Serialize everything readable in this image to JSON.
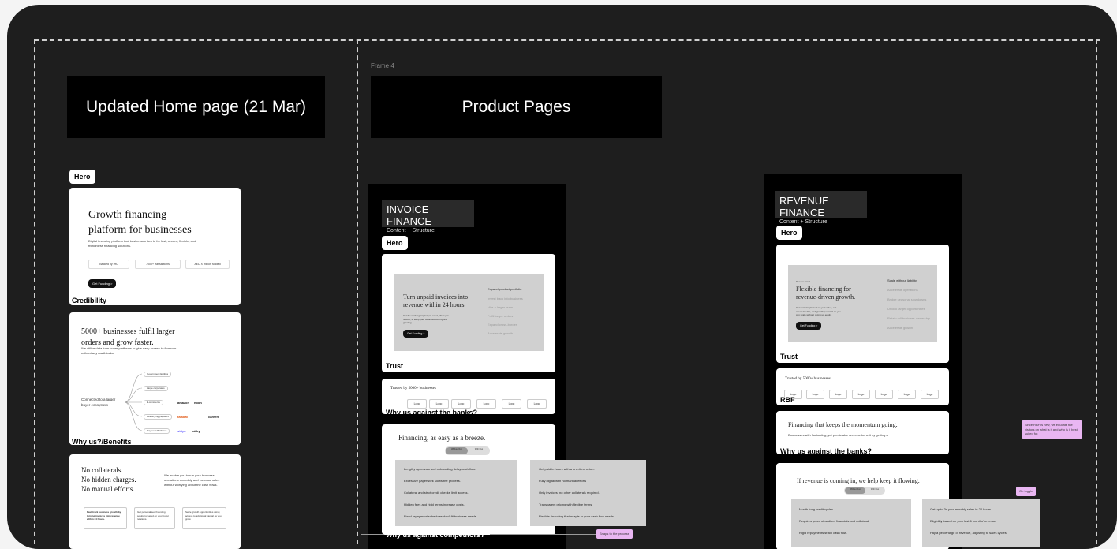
{
  "canvas": {
    "frame_label": "Frame 4",
    "title_home": "Updated Home page (21 Mar)",
    "title_product": "Product Pages"
  },
  "home": {
    "hero_tag": "Hero",
    "hero_heading_line1": "Growth financing",
    "hero_heading_line2": "platform for businesses",
    "hero_sub": "Digital financing platform that businesses turn to for fast, secure, flexible, and frictionless financing solutions.",
    "stats": [
      "Backed by IHC",
      "7000+ transactions",
      "AED X million funded"
    ],
    "cta": "Get Funding >",
    "credibility_tag": "Credibility",
    "cred_heading_line1": "5000+ businesses fulfil larger",
    "cred_heading_line2": "orders and grow faster.",
    "cred_sub": "We utilise data from buyer platforms to give easy access to finances without any roadblocks.",
    "ecosystem_label": "Connected to a larger buyer ecosystem",
    "ecosystem_branches": [
      "Government Entities",
      "Large corporates",
      "E-commerce",
      "Delivery Aggregators",
      "Payment Platforms"
    ],
    "brands": [
      "amazon",
      "noon",
      "careem",
      "talabat",
      "stripe",
      "tabby"
    ],
    "why_tag": "Why us?/Benefits",
    "why_lines": [
      "No collaterals.",
      "No hidden charges.",
      "No manual efforts."
    ],
    "why_sub": "We enable you to run your business operations smoothly and increase sales without worrying about the cash flows.",
    "why_boxes": [
      "Fast-track business growth by turning invoices into revenue within 24 hours.",
      "Get personalised financing solutions based on your buyer relations.",
      "Seize growth opportunities using access to additional capital as you grow."
    ]
  },
  "invoice": {
    "title": "INVOICE FINANCE",
    "subtitle": "Content + Structure",
    "hero_tag": "Hero",
    "hero_heading": "Turn unpaid invoices into revenue within 24 hours.",
    "hero_sub": "Get the working capital you need, when you need it, to keep your business moving and growing.",
    "cta": "Get Funding >",
    "right_title": "Expand product portfolio",
    "right_items": [
      "Invest back into business",
      "Hire a larger team",
      "Fulfil larger orders",
      "Expand cross-border",
      "Accelerate growth"
    ],
    "trust_tag": "Trust",
    "trusted_by": "Trusted by 5000+ businesses",
    "logos": [
      "Logo",
      "Logo",
      "Logo",
      "Logo",
      "Logo",
      "Logo"
    ],
    "why_banks_tag": "Why us against the banks?",
    "breeze_heading": "Financing, as easy as a breeze.",
    "toggle": [
      "Without Oxo",
      "With Oxo"
    ],
    "left_list": [
      "Lengthy approvals and onboarding delay cash flow.",
      "Excessive paperwork slows the process.",
      "Collateral and strict credit checks limit access.",
      "Hidden fees and rigid terms increase costs.",
      "Fixed repayment schedules don't fit business needs."
    ],
    "right_list": [
      "Get paid in hours with a one-time setup.",
      "Fully digital with no manual efforts",
      "Only invoices, no other collaterals required.",
      "Transparent pricing with flexible terms.",
      "Flexible financing that adapts to your cash flow needs."
    ],
    "competitors_tag": "Why us against competitors?",
    "snaps_note": "Snaps to the process"
  },
  "revenue": {
    "title": "REVENUE FINANCE",
    "subtitle": "Content + Structure",
    "hero_tag": "Hero",
    "eyebrow": "Revenue Based",
    "hero_heading": "Flexible financing for revenue-driven growth.",
    "hero_sub": "Get financing based on your sales, not assets/credits, and growth potential as you can scale without giving up equity.",
    "cta": "Get Funding >",
    "right_title": "Scale without liability",
    "right_items": [
      "Accelerate operations",
      "Bridge seasonal slowdowns",
      "Unlock larger opportunities",
      "Retain full business ownership",
      "Accelerate growth"
    ],
    "trust_tag": "Trust",
    "trusted_by": "Trusted by 5000+ businesses",
    "logos": [
      "Logo",
      "Logo",
      "Logo",
      "Logo",
      "Logo",
      "Logo",
      "Logo"
    ],
    "rbf_tag": "RBF",
    "momentum_heading": "Financing that keeps the momentum going.",
    "momentum_sub": "Businesses with fluctuating, yet predictable revenue benefit by getting a",
    "rbf_note": "Since RBF is new, we educate the visitors on what is it and who is it best suited for.",
    "why_banks_tag": "Why us against the banks?",
    "flow_heading": "If revenue is coming in, we help keep it flowing.",
    "toggle": [
      "Without Oxo",
      "With Oxo"
    ],
    "toggle_note": "On toggle",
    "left_list": [
      "Month-long credit cycles.",
      "Requires years of audited financials and collateral.",
      "Rigid repayments strain cash flow."
    ],
    "right_list": [
      "Get up to 3x your monthly sales in 24 hours.",
      "Eligibility based on your last 6 months' revenue.",
      "Pay a percentage of revenue, adjusting to sales cycles."
    ]
  }
}
